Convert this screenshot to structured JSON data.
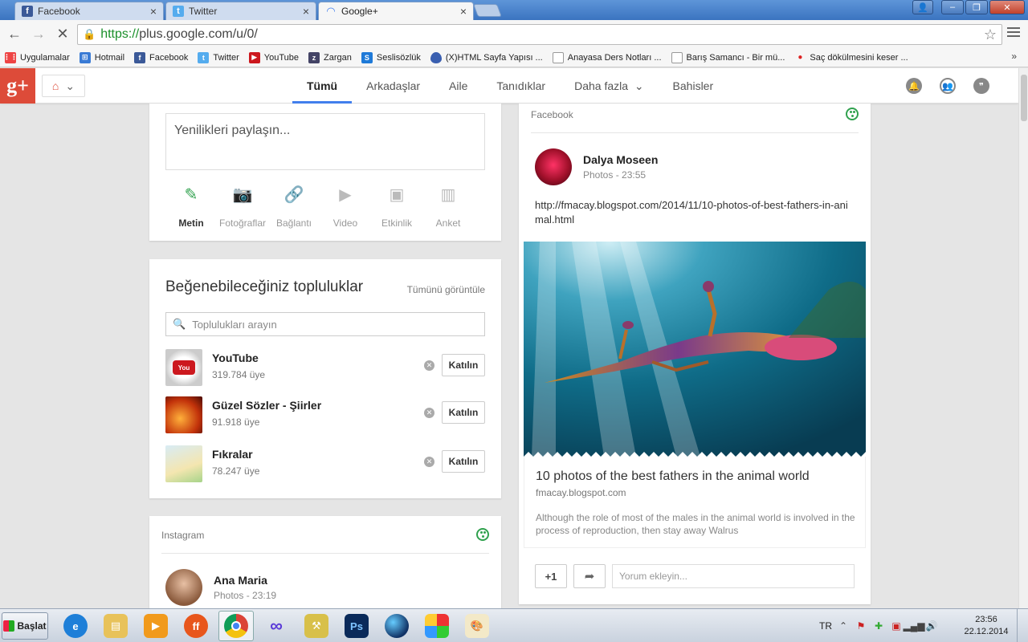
{
  "browser": {
    "tabs": [
      {
        "label": "Facebook",
        "icon": "facebook-icon",
        "color": "#3b5998"
      },
      {
        "label": "Twitter",
        "icon": "twitter-icon",
        "color": "#55acee"
      },
      {
        "label": "Google+",
        "icon": "loading-spinner-icon",
        "color": "#427fed"
      }
    ],
    "url_https": "https://",
    "url_rest": "plus.google.com/u/0/",
    "bookmarks": [
      {
        "label": "Uygulamalar",
        "icon": "apps-grid-icon",
        "color": "#e44"
      },
      {
        "label": "Hotmail",
        "icon": "windows-icon",
        "color": "#3a7bd5"
      },
      {
        "label": "Facebook",
        "icon": "facebook-icon",
        "color": "#3b5998"
      },
      {
        "label": "Twitter",
        "icon": "twitter-icon",
        "color": "#55acee"
      },
      {
        "label": "YouTube",
        "icon": "youtube-icon",
        "color": "#cc181e"
      },
      {
        "label": "Zargan",
        "icon": "zargan-icon",
        "color": "#446"
      },
      {
        "label": "Seslisözlük",
        "icon": "seslisozluk-icon",
        "color": "#1f7ad8"
      },
      {
        "label": "(X)HTML Sayfa Yapısı ...",
        "icon": "drop-icon",
        "color": "#3a5fb0"
      },
      {
        "label": "Anayasa Ders Notları ...",
        "icon": "page-icon",
        "color": "#999"
      },
      {
        "label": "Barış Samancı - Bir mü...",
        "icon": "page-icon",
        "color": "#999"
      },
      {
        "label": "Saç dökülmesini keser ...",
        "icon": "dot-icon",
        "color": "#d22"
      }
    ],
    "more": "»"
  },
  "gplus": {
    "logo": "g+",
    "nav": [
      "Tümü",
      "Arkadaşlar",
      "Aile",
      "Tanıdıklar",
      "Daha fazla",
      "Bahisler"
    ],
    "nav_more_caret": "⌄"
  },
  "compose": {
    "placeholder": "Yenilikleri paylaşın...",
    "tools": [
      {
        "label": "Metin",
        "icon": "pencil-icon"
      },
      {
        "label": "Fotoğraflar",
        "icon": "camera-icon"
      },
      {
        "label": "Bağlantı",
        "icon": "link-icon"
      },
      {
        "label": "Video",
        "icon": "video-icon"
      },
      {
        "label": "Etkinlik",
        "icon": "event-icon"
      },
      {
        "label": "Anket",
        "icon": "poll-icon"
      }
    ]
  },
  "communities": {
    "title": "Beğenebileceğiniz topluluklar",
    "view_all": "Tümünü görüntüle",
    "search_placeholder": "Toplulukları arayın",
    "join_label": "Katılın",
    "items": [
      {
        "name": "YouTube",
        "members": "319.784 üye"
      },
      {
        "name": "Güzel Sözler - Şiirler",
        "members": "91.918 üye"
      },
      {
        "name": "Fıkralar",
        "members": "78.247 üye"
      }
    ]
  },
  "instagram_post": {
    "source": "Instagram",
    "author": "Ana Maria",
    "meta": "Photos  -  23:19"
  },
  "facebook_post": {
    "source": "Facebook",
    "author": "Dalya Moseen",
    "meta": "Photos  -  23:55",
    "url_text": "http://fmacay.blogspot.com/2014/11/10-photos-of-best-fathers-in-animal.html",
    "link_title": "10 photos of the best fathers in the animal world",
    "link_domain": "fmacay.blogspot.com",
    "link_desc": "Although the role of most of the males in the animal world is involved in the process of reproduction, then stay away Walrus",
    "plus_one": "+1",
    "comment_placeholder": "Yorum ekleyin..."
  },
  "taskbar": {
    "start_label": "Başlat",
    "language": "TR",
    "time": "23:56",
    "date": "22.12.2014"
  }
}
